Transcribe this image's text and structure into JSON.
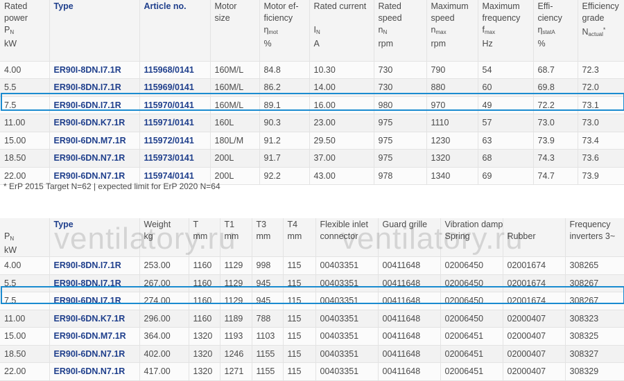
{
  "table1": {
    "header": [
      {
        "line1": "Rated",
        "line2": "power",
        "sym": "P",
        "sub": "N",
        "unit": "kW",
        "style": "plain"
      },
      {
        "line1": "Type",
        "line2": "",
        "sym": "",
        "sub": "",
        "unit": "",
        "style": "bold"
      },
      {
        "line1": "Article no.",
        "line2": "",
        "sym": "",
        "sub": "",
        "unit": "",
        "style": "bold"
      },
      {
        "line1": "Motor",
        "line2": "size",
        "sym": "",
        "sub": "",
        "unit": "",
        "style": "plain"
      },
      {
        "line1": "Motor ef-",
        "line2": "ficiency",
        "sym": "η",
        "sub": "mot",
        "unit": "%",
        "style": "plain"
      },
      {
        "line1": "Rated current",
        "line2": "",
        "sym": "I",
        "sub": "N",
        "unit": "A",
        "style": "plain"
      },
      {
        "line1": "Rated",
        "line2": "speed",
        "sym": "n",
        "sub": "N",
        "unit": "rpm",
        "style": "plain"
      },
      {
        "line1": "Maximum",
        "line2": "speed",
        "sym": "n",
        "sub": "max",
        "unit": "rpm",
        "style": "plain"
      },
      {
        "line1": "Maximum",
        "line2": "frequency",
        "sym": "f",
        "sub": "max",
        "unit": "Hz",
        "style": "plain"
      },
      {
        "line1": "Effi-",
        "line2": "ciency",
        "sym": "η",
        "sub": "statA",
        "unit": "%",
        "style": "plain"
      },
      {
        "line1": "Efficiency",
        "line2": "grade",
        "sym": "N",
        "sub": "actual",
        "unit": "",
        "sup": "*",
        "style": "plain"
      }
    ],
    "rows": [
      [
        "4.00",
        "ER90I-8DN.I7.1R",
        "115968/0141",
        "160M/L",
        "84.8",
        "10.30",
        "730",
        "790",
        "54",
        "68.7",
        "72.3"
      ],
      [
        "5.5",
        "ER90I-8DN.I7.1R",
        "115969/0141",
        "160M/L",
        "86.2",
        "14.00",
        "730",
        "880",
        "60",
        "69.8",
        "72.0"
      ],
      [
        "7.5",
        "ER90I-6DN.I7.1R",
        "115970/0141",
        "160M/L",
        "89.1",
        "16.00",
        "980",
        "970",
        "49",
        "72.2",
        "73.1"
      ],
      [
        "11.00",
        "ER90I-6DN.K7.1R",
        "115971/0141",
        "160L",
        "90.3",
        "23.00",
        "975",
        "1110",
        "57",
        "73.0",
        "73.0"
      ],
      [
        "15.00",
        "ER90I-6DN.M7.1R",
        "115972/0141",
        "180L/M",
        "91.2",
        "29.50",
        "975",
        "1230",
        "63",
        "73.9",
        "73.4"
      ],
      [
        "18.50",
        "ER90I-6DN.N7.1R",
        "115973/0141",
        "200L",
        "91.7",
        "37.00",
        "975",
        "1320",
        "68",
        "74.3",
        "73.6"
      ],
      [
        "22.00",
        "ER90I-6DN.N7.1R",
        "115974/0141",
        "200L",
        "92.2",
        "43.00",
        "978",
        "1340",
        "69",
        "74.7",
        "73.9"
      ]
    ]
  },
  "footnote": "* ErP 2015 Target N=62 | expected limit for ErP 2020 N=64",
  "table2": {
    "header": [
      {
        "line1": "",
        "line2": "",
        "sym": "P",
        "sub": "N",
        "unit": "kW",
        "style": "plain"
      },
      {
        "line1": "Type",
        "line2": "",
        "sym": "",
        "sub": "",
        "unit": "",
        "style": "bold"
      },
      {
        "line1": "Weight",
        "line2": "",
        "sym": "",
        "sub": "",
        "unit": "kg",
        "style": "plain"
      },
      {
        "line1": "T",
        "line2": "",
        "sym": "",
        "sub": "",
        "unit": "mm",
        "style": "plain"
      },
      {
        "line1": "T1",
        "line2": "",
        "sym": "",
        "sub": "",
        "unit": "mm",
        "style": "plain"
      },
      {
        "line1": "T3",
        "line2": "",
        "sym": "",
        "sub": "",
        "unit": "mm",
        "style": "plain"
      },
      {
        "line1": "T4",
        "line2": "",
        "sym": "",
        "sub": "",
        "unit": "mm",
        "style": "plain"
      },
      {
        "line1": "Flexible inlet",
        "line2": "connector",
        "sym": "",
        "sub": "",
        "unit": "",
        "style": "plain"
      },
      {
        "line1": "Guard grille",
        "line2": "",
        "sym": "",
        "sub": "",
        "unit": "",
        "style": "plain"
      },
      {
        "line1": "Vibration damper",
        "line2": "",
        "sym": "",
        "sub": "",
        "unit": "Spring",
        "style": "plain"
      },
      {
        "line1": "",
        "line2": "",
        "sym": "",
        "sub": "",
        "unit": "Rubber",
        "style": "plain"
      },
      {
        "line1": "Frequency",
        "line2": "inverters 3~",
        "sym": "",
        "sub": "",
        "unit": "",
        "style": "plain"
      }
    ],
    "rows": [
      [
        "4.00",
        "ER90I-8DN.I7.1R",
        "253.00",
        "1160",
        "1129",
        "998",
        "115",
        "00403351",
        "00411648",
        "02006450",
        "02001674",
        "308265"
      ],
      [
        "5.5",
        "ER90I-8DN.I7.1R",
        "267.00",
        "1160",
        "1129",
        "945",
        "115",
        "00403351",
        "00411648",
        "02006450",
        "02001674",
        "308267"
      ],
      [
        "7.5",
        "ER90I-6DN.I7.1R",
        "274.00",
        "1160",
        "1129",
        "945",
        "115",
        "00403351",
        "00411648",
        "02006450",
        "02001674",
        "308267"
      ],
      [
        "11.00",
        "ER90I-6DN.K7.1R",
        "296.00",
        "1160",
        "1189",
        "788",
        "115",
        "00403351",
        "00411648",
        "02006450",
        "02000407",
        "308323"
      ],
      [
        "15.00",
        "ER90I-6DN.M7.1R",
        "364.00",
        "1320",
        "1193",
        "1103",
        "115",
        "00403351",
        "00411648",
        "02006451",
        "02000407",
        "308325"
      ],
      [
        "18.50",
        "ER90I-6DN.N7.1R",
        "402.00",
        "1320",
        "1246",
        "1155",
        "115",
        "00403351",
        "00411648",
        "02006451",
        "02000407",
        "308327"
      ],
      [
        "22.00",
        "ER90I-6DN.N7.1R",
        "417.00",
        "1320",
        "1271",
        "1155",
        "115",
        "00403351",
        "00411648",
        "02006451",
        "02000407",
        "308329"
      ]
    ]
  },
  "watermark": "ventilatory.ru",
  "colors": {
    "highlight_border": "#1a8bd0",
    "link_text": "#1f3f8c"
  }
}
